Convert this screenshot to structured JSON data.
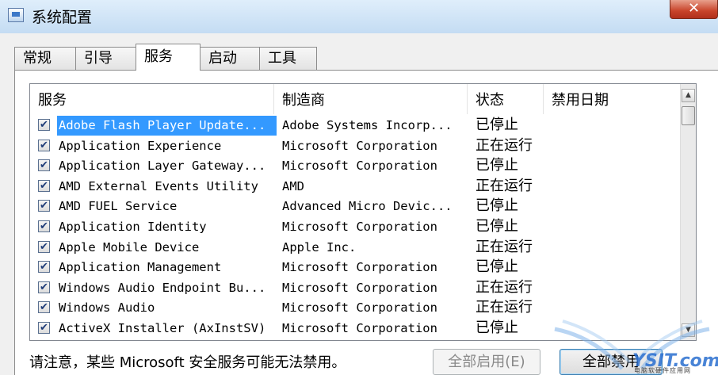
{
  "window": {
    "title": "系统配置",
    "close_glyph": "✕"
  },
  "tabs": [
    {
      "label": "常规",
      "active": false
    },
    {
      "label": "引导",
      "active": false
    },
    {
      "label": "服务",
      "active": true
    },
    {
      "label": "启动",
      "active": false
    },
    {
      "label": "工具",
      "active": false
    }
  ],
  "list": {
    "columns": [
      "服务",
      "制造商",
      "状态",
      "禁用日期"
    ],
    "rows": [
      {
        "checked": true,
        "name": "Adobe Flash Player Update...",
        "maker": "Adobe Systems Incorp...",
        "status": "已停止",
        "date": "",
        "selected": true
      },
      {
        "checked": true,
        "name": "Application Experience",
        "maker": "Microsoft Corporation",
        "status": "正在运行",
        "date": ""
      },
      {
        "checked": true,
        "name": "Application Layer Gateway...",
        "maker": "Microsoft Corporation",
        "status": "已停止",
        "date": ""
      },
      {
        "checked": true,
        "name": "AMD External Events Utility",
        "maker": "AMD",
        "status": "正在运行",
        "date": ""
      },
      {
        "checked": true,
        "name": "AMD FUEL Service",
        "maker": "Advanced Micro Devic...",
        "status": "已停止",
        "date": ""
      },
      {
        "checked": true,
        "name": "Application Identity",
        "maker": "Microsoft Corporation",
        "status": "已停止",
        "date": ""
      },
      {
        "checked": true,
        "name": "Apple Mobile Device",
        "maker": "Apple Inc.",
        "status": "正在运行",
        "date": ""
      },
      {
        "checked": true,
        "name": "Application Management",
        "maker": "Microsoft Corporation",
        "status": "已停止",
        "date": ""
      },
      {
        "checked": true,
        "name": "Windows Audio Endpoint Bu...",
        "maker": "Microsoft Corporation",
        "status": "正在运行",
        "date": ""
      },
      {
        "checked": true,
        "name": "Windows Audio",
        "maker": "Microsoft Corporation",
        "status": "正在运行",
        "date": ""
      },
      {
        "checked": true,
        "name": "ActiveX Installer (AxInstSV)",
        "maker": "Microsoft Corporation",
        "status": "已停止",
        "date": ""
      }
    ],
    "check_glyph": "✔"
  },
  "footer": {
    "note": "请注意，某些 Microsoft 安全服务可能无法禁用。",
    "enable_all_label": "全部启用(E)",
    "disable_all_label": "全部禁用"
  },
  "watermark": {
    "text": "YSIT.com",
    "subtext": "电脑软硬件应用网"
  }
}
